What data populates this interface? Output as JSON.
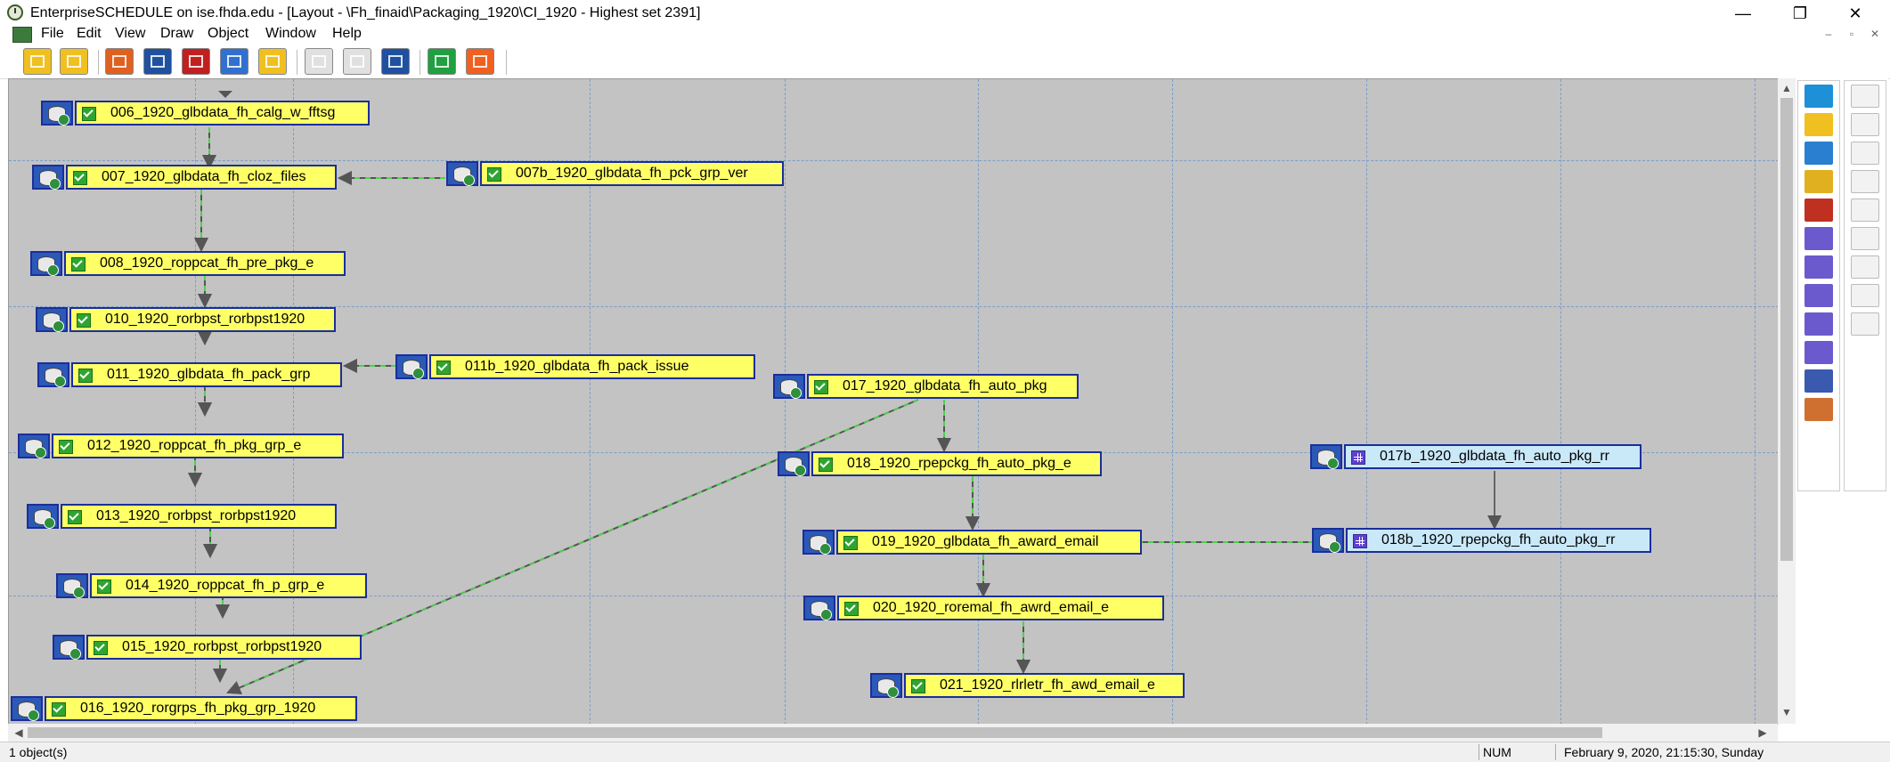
{
  "window": {
    "title": "EnterpriseSCHEDULE on ise.fhda.edu  - [Layout - \\Fh_finaid\\Packaging_1920\\CI_1920 - Highest set 2391]",
    "minimize": "—",
    "restore": "❐",
    "close": "✕"
  },
  "menu": {
    "items": [
      "File",
      "Edit",
      "View",
      "Draw",
      "Object",
      "Window",
      "Help"
    ],
    "mdi_minimize": "–",
    "mdi_restore": "▫",
    "mdi_close": "✕"
  },
  "toolbar": {
    "buttons": [
      {
        "name": "open-icon",
        "color": "#f0c020"
      },
      {
        "name": "save-icon",
        "color": "#f0c020"
      },
      {
        "name": "find-icon",
        "color": "#e06020"
      },
      {
        "name": "monitor-icon",
        "color": "#2050a0"
      },
      {
        "name": "terminal-icon",
        "color": "#c02020"
      },
      {
        "name": "document-icon",
        "color": "#3070d0"
      },
      {
        "name": "report-icon",
        "color": "#f0c020"
      },
      {
        "name": "cut-icon",
        "color": "#e0e0e0"
      },
      {
        "name": "copy-icon",
        "color": "#e0e0e0"
      },
      {
        "name": "paste-icon",
        "color": "#2050a0"
      },
      {
        "name": "print-icon",
        "color": "#20a040"
      },
      {
        "name": "help-icon",
        "color": "#f06020"
      }
    ]
  },
  "jobs": [
    {
      "id": "006",
      "label": "006_1920_glbdata_fh_calg_w_fftsg",
      "type": "yellow"
    },
    {
      "id": "007",
      "label": "007_1920_glbdata_fh_cloz_files",
      "type": "yellow"
    },
    {
      "id": "007b",
      "label": "007b_1920_glbdata_fh_pck_grp_ver",
      "type": "yellow"
    },
    {
      "id": "008",
      "label": "008_1920_roppcat_fh_pre_pkg_e",
      "type": "yellow"
    },
    {
      "id": "010",
      "label": "010_1920_rorbpst_rorbpst1920",
      "type": "yellow"
    },
    {
      "id": "011",
      "label": "011_1920_glbdata_fh_pack_grp",
      "type": "yellow"
    },
    {
      "id": "011b",
      "label": "011b_1920_glbdata_fh_pack_issue",
      "type": "yellow"
    },
    {
      "id": "012",
      "label": "012_1920_roppcat_fh_pkg_grp_e",
      "type": "yellow"
    },
    {
      "id": "013",
      "label": "013_1920_rorbpst_rorbpst1920",
      "type": "yellow"
    },
    {
      "id": "014",
      "label": "014_1920_roppcat_fh_p_grp_e",
      "type": "yellow"
    },
    {
      "id": "015",
      "label": "015_1920_rorbpst_rorbpst1920",
      "type": "yellow"
    },
    {
      "id": "016",
      "label": "016_1920_rorgrps_fh_pkg_grp_1920",
      "type": "yellow"
    },
    {
      "id": "017",
      "label": "017_1920_glbdata_fh_auto_pkg",
      "type": "yellow"
    },
    {
      "id": "018",
      "label": "018_1920_rpepckg_fh_auto_pkg_e",
      "type": "yellow"
    },
    {
      "id": "019",
      "label": "019_1920_glbdata_fh_award_email",
      "type": "yellow"
    },
    {
      "id": "020",
      "label": "020_1920_roremal_fh_awrd_email_e",
      "type": "yellow"
    },
    {
      "id": "021",
      "label": "021_1920_rlrletr_fh_awd_email_e",
      "type": "yellow"
    },
    {
      "id": "017b",
      "label": "017b_1920_glbdata_fh_auto_pkg_rr",
      "type": "blue"
    },
    {
      "id": "018b",
      "label": "018b_1920_rpepckg_fh_auto_pkg_rr",
      "type": "blue"
    }
  ],
  "palette": {
    "tools": [
      "select-arrow-icon",
      "flow-diagram-icon",
      "tree-diagram-icon",
      "new-job-icon",
      "script-icon",
      "line-tool-icon",
      "rectangle-tool-icon",
      "rounded-rect-tool-icon",
      "ellipse-tool-icon",
      "polygon-tool-icon",
      "text-tool-icon",
      "link-tool-icon"
    ],
    "disabled_tools": [
      "list-icon",
      "play-icon",
      "log-icon",
      "table-icon",
      "message-icon",
      "pie-chart-icon",
      "clock-chart-icon",
      "clock-icon",
      "calendar-icon"
    ]
  },
  "status": {
    "selection": "1 object(s)",
    "num": "NUM",
    "datetime": "February 9, 2020, 21:15:30, Sunday"
  }
}
